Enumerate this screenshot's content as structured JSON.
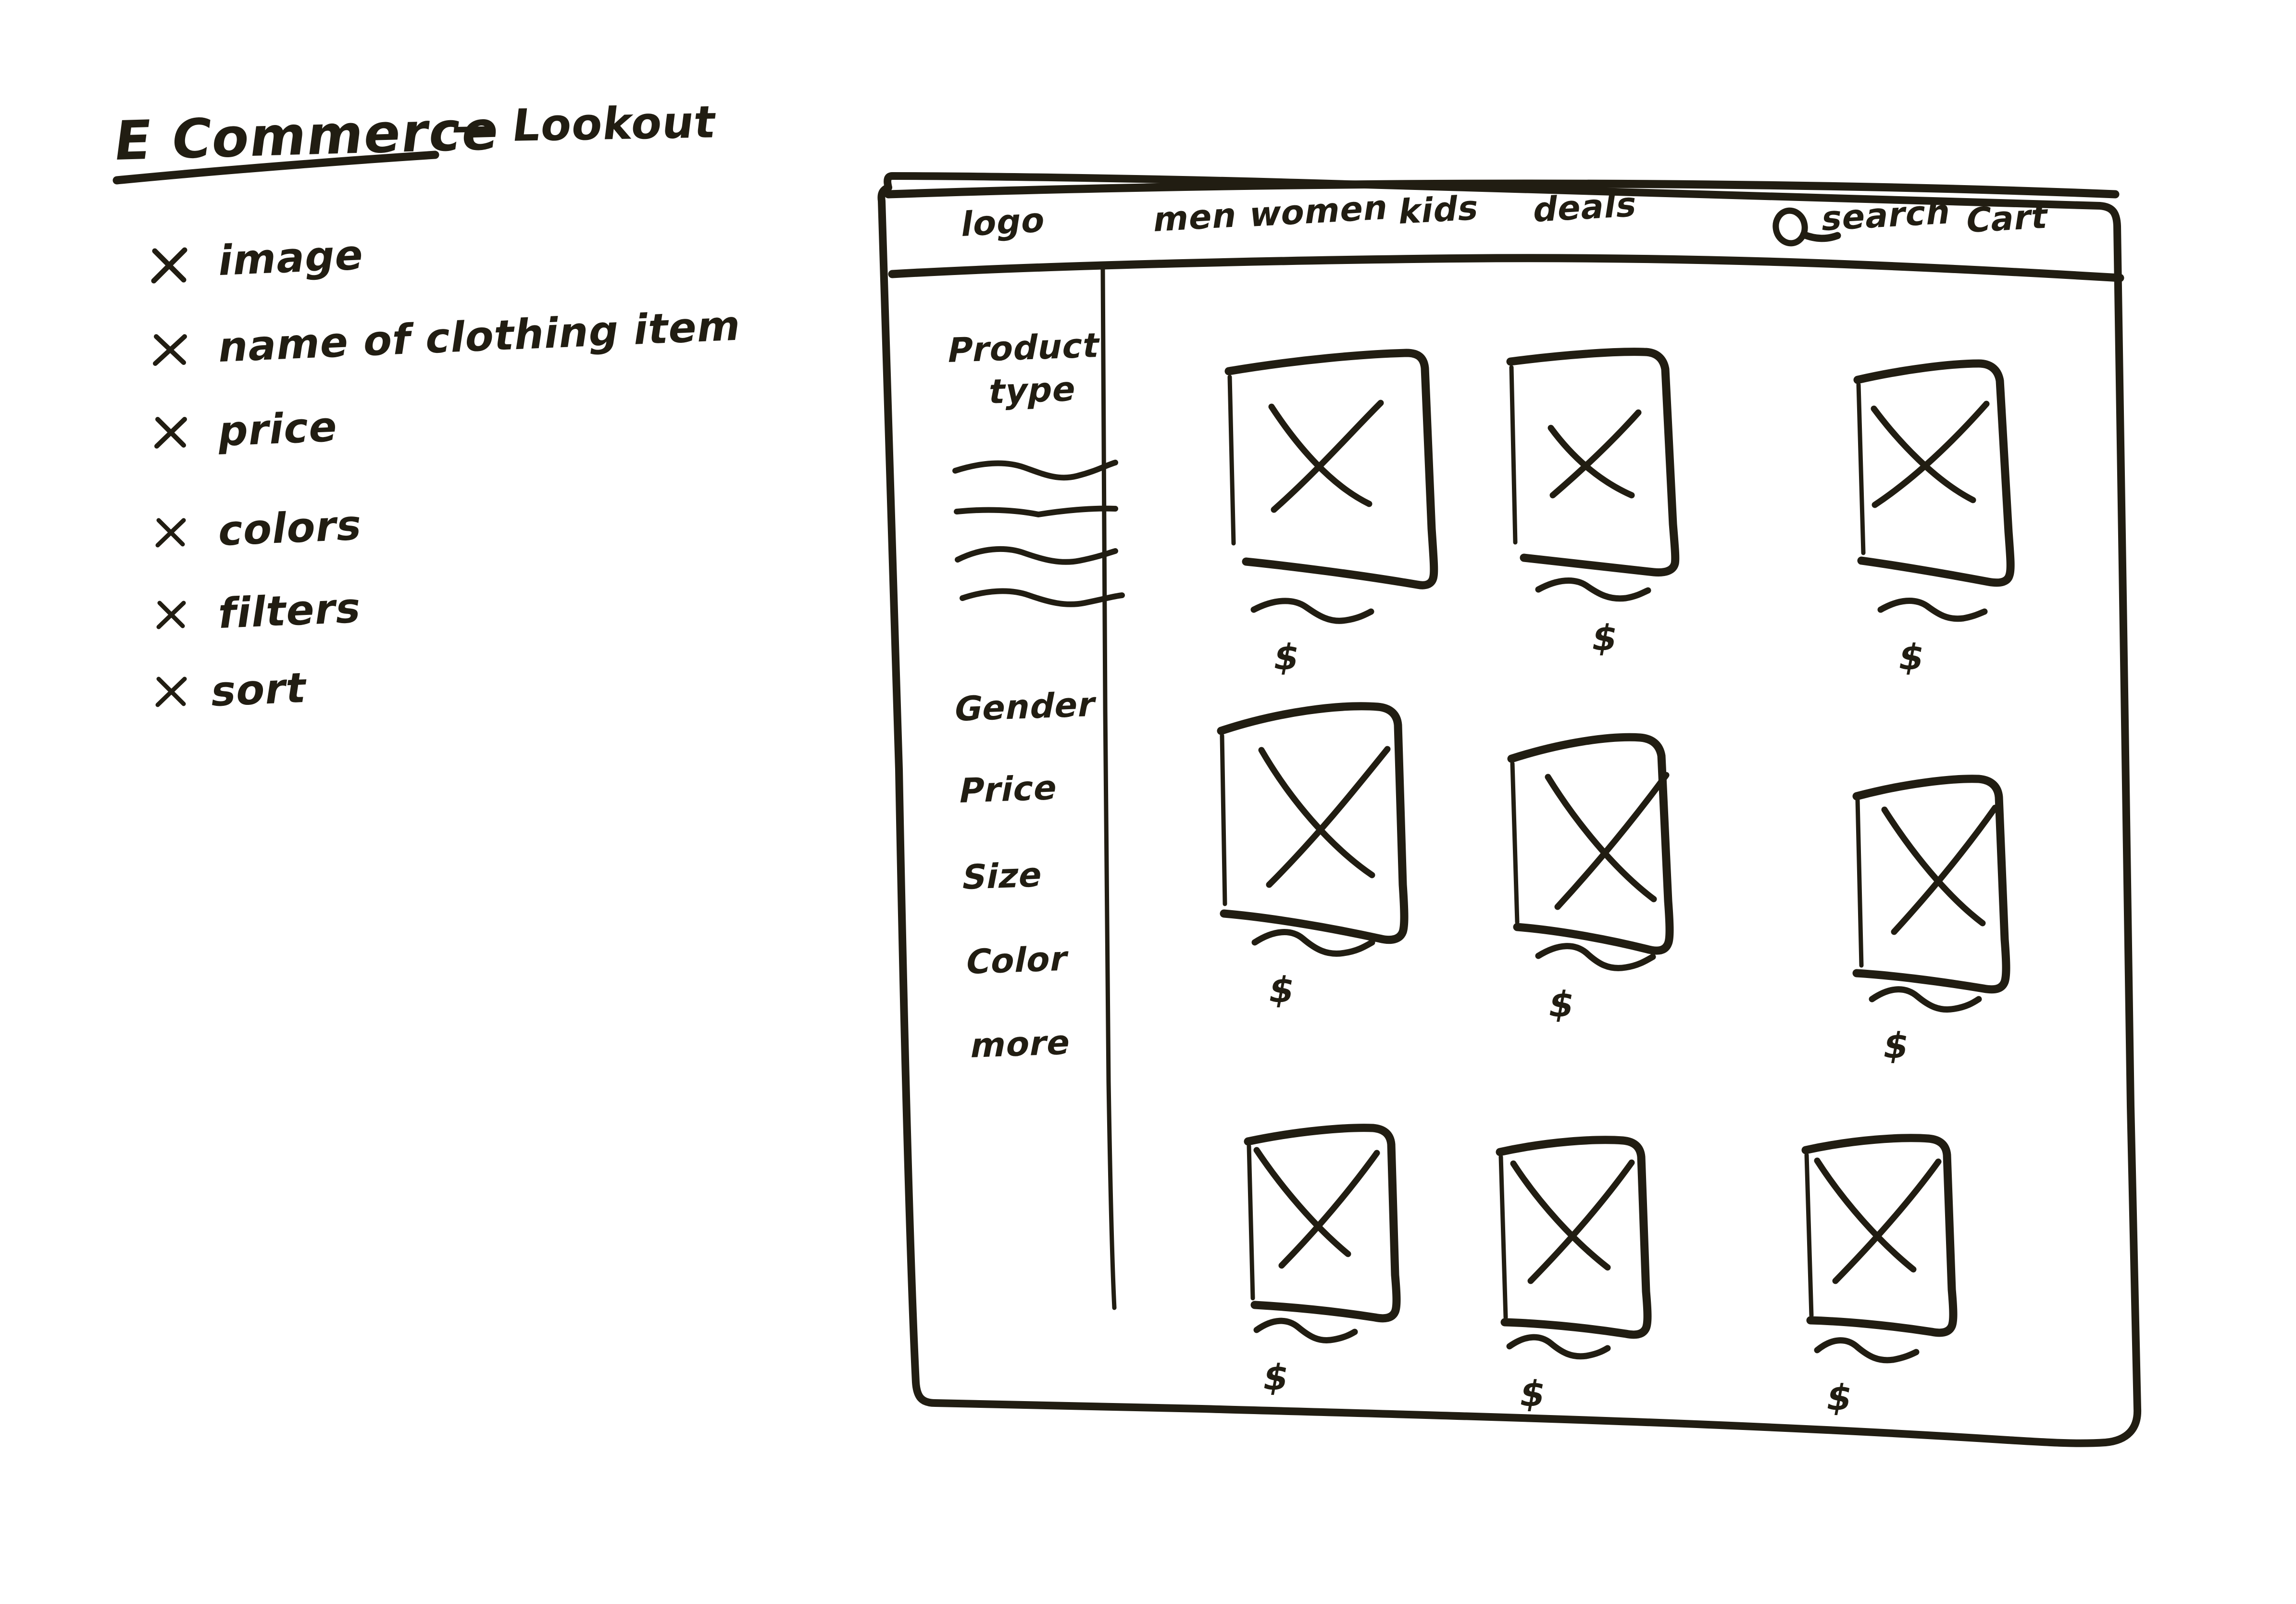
{
  "sketch": {
    "title": "E Commerce",
    "title_suffix": "— Lookout",
    "ink_color": "#211d12",
    "paper_color": "#ffffff"
  },
  "notes": {
    "bullet_glyph": "X",
    "items": [
      {
        "marker": "X",
        "label": "image"
      },
      {
        "marker": "X",
        "label": "name of clothing item"
      },
      {
        "marker": "X",
        "label": "price"
      },
      {
        "marker": "x",
        "label": "colors"
      },
      {
        "marker": "x",
        "label": "filters"
      },
      {
        "marker": "x",
        "label": "sort"
      }
    ]
  },
  "wireframe": {
    "header": {
      "logo": "logo",
      "nav_items": [
        "men",
        "women",
        "kids",
        "deals"
      ],
      "search_icon": "search-icon",
      "search_label": "search",
      "cart_label": "Cart"
    },
    "sidebar": {
      "heading_line1": "Product",
      "heading_line2": "type",
      "placeholder_line_count": 4,
      "filters": [
        "Gender",
        "Price",
        "Size",
        "Color",
        "more"
      ]
    },
    "grid": {
      "columns": 3,
      "rows": 3,
      "cards": [
        {
          "image_placeholder": "x-box",
          "name_placeholder": "squiggle",
          "price": "$"
        },
        {
          "image_placeholder": "x-box",
          "name_placeholder": "squiggle",
          "price": "$"
        },
        {
          "image_placeholder": "x-box",
          "name_placeholder": "squiggle",
          "price": "$"
        },
        {
          "image_placeholder": "x-box",
          "name_placeholder": "squiggle",
          "price": "$"
        },
        {
          "image_placeholder": "x-box",
          "name_placeholder": "squiggle",
          "price": "$"
        },
        {
          "image_placeholder": "x-box",
          "name_placeholder": "squiggle",
          "price": "$"
        },
        {
          "image_placeholder": "x-box",
          "name_placeholder": "squiggle",
          "price": "$"
        },
        {
          "image_placeholder": "x-box",
          "name_placeholder": "squiggle",
          "price": "$"
        },
        {
          "image_placeholder": "x-box",
          "name_placeholder": "squiggle",
          "price": "$"
        }
      ]
    }
  }
}
